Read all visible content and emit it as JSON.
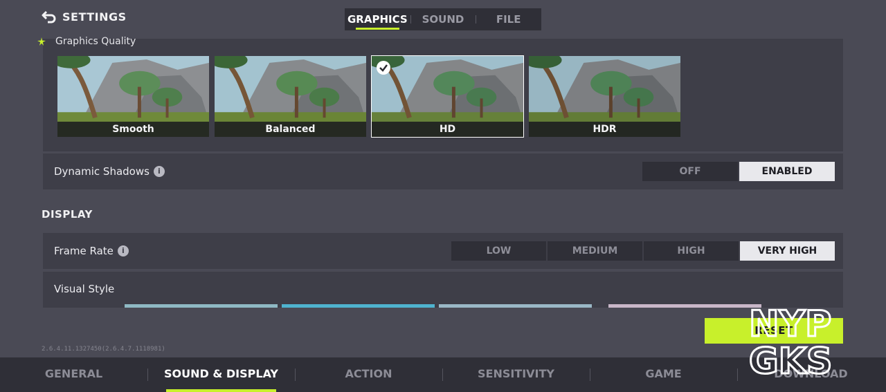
{
  "header": {
    "title": "SETTINGS",
    "tabs": [
      "GRAPHICS",
      "SOUND",
      "FILE"
    ],
    "active_tab": "GRAPHICS"
  },
  "graphics_quality": {
    "label": "Graphics Quality",
    "options": [
      "Smooth",
      "Balanced",
      "HD",
      "HDR"
    ],
    "selected": "HD"
  },
  "dynamic_shadows": {
    "label": "Dynamic Shadows",
    "options": [
      "OFF",
      "ENABLED"
    ],
    "selected": "ENABLED"
  },
  "display": {
    "section_title": "DISPLAY",
    "frame_rate": {
      "label": "Frame Rate",
      "options": [
        "LOW",
        "MEDIUM",
        "HIGH",
        "VERY HIGH"
      ],
      "selected": "VERY HIGH"
    },
    "visual_style": {
      "label": "Visual Style"
    }
  },
  "version": "2.6.4.11.1327450(2.6.4.7.1118981)",
  "reset_label": "RESET",
  "bottom_nav": {
    "items": [
      "GENERAL",
      "SOUND & DISPLAY",
      "ACTION",
      "SENSITIVITY",
      "GAME",
      "DOWNLOAD"
    ],
    "active": "SOUND & DISPLAY"
  },
  "watermark": {
    "line1": "NYP",
    "line2": "GKS"
  },
  "colors": {
    "accent": "#c8f02b",
    "background": "#4a4a55",
    "panel": "#3e3e48"
  }
}
